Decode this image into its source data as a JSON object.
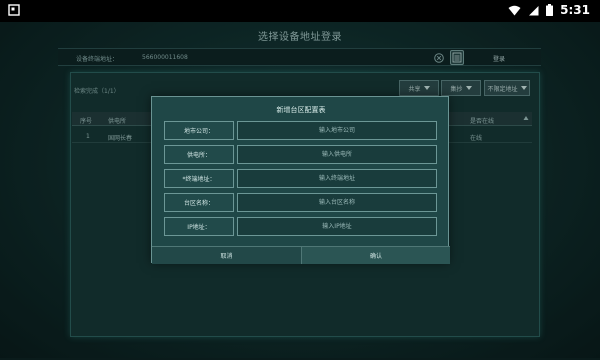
{
  "status_bar": {
    "time": "5:31"
  },
  "page": {
    "title": "选择设备地址登录"
  },
  "address_bar": {
    "label": "设备终端地址：",
    "value": "566000011608",
    "login_label": "登录"
  },
  "results": {
    "label": "检索完成（1/1）",
    "buttons": [
      "共享",
      "集抄",
      "不限定地址"
    ]
  },
  "table": {
    "headers": [
      "序号",
      "供电所",
      "是否在线"
    ],
    "rows": [
      {
        "index": "1",
        "name": "国网长春",
        "status": "在线"
      }
    ]
  },
  "dialog": {
    "title": "新增台区配置表",
    "fields": [
      {
        "label": "地市公司：",
        "placeholder": "输入地市公司"
      },
      {
        "label": "供电所：",
        "placeholder": "输入供电所"
      },
      {
        "label": "*终端地址：",
        "placeholder": "输入终端地址"
      },
      {
        "label": "台区名称：",
        "placeholder": "输入台区名称"
      },
      {
        "label": "IP地址：",
        "placeholder": "输入IP地址"
      }
    ],
    "cancel_label": "取消",
    "confirm_label": "确认"
  },
  "colors": {
    "background": "#12302f",
    "dialog": "#1f4747",
    "border": "#6c9796",
    "text": "#d3e7e6"
  }
}
